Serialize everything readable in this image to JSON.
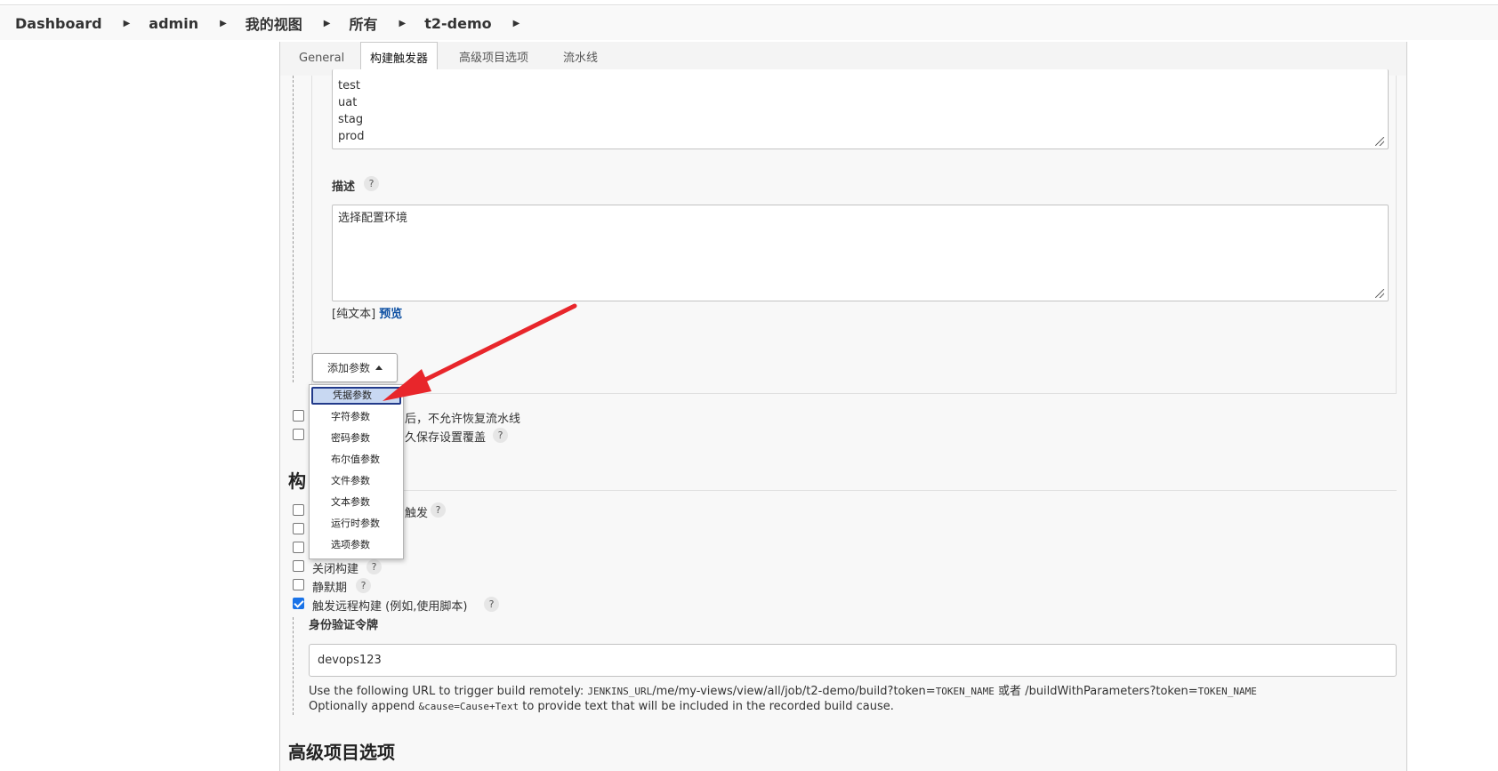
{
  "breadcrumb": [
    "Dashboard",
    "admin",
    "我的视图",
    "所有",
    "t2-demo"
  ],
  "tabs": [
    "General",
    "构建触发器",
    "高级项目选项",
    "流水线"
  ],
  "active_tab": "构建触发器",
  "choices_textarea": "test\nuat\nstag\nprod",
  "description": {
    "label": "描述",
    "value": "选择配置环境",
    "format_label": "[纯文本]",
    "preview_link": "预览"
  },
  "add_param_button": "添加参数",
  "dropdown_items": [
    "凭据参数",
    "字符参数",
    "密码参数",
    "布尔值参数",
    "文件参数",
    "文本参数",
    "运行时参数",
    "选项参数"
  ],
  "dropdown_selected": "凭据参数",
  "general_options": [
    {
      "label_visible": "后，不允许恢复流水线",
      "checked": false
    },
    {
      "label_visible": "久保存设置覆盖",
      "checked": false
    }
  ],
  "build_triggers": {
    "title_visible": "构",
    "items": [
      {
        "label_visible": "触发",
        "checked": false
      },
      {
        "label_visible": "",
        "checked": false
      },
      {
        "label_visible": "",
        "checked": false
      },
      {
        "label_visible": "关闭构建",
        "checked": false
      },
      {
        "label_visible": "静默期",
        "checked": false
      },
      {
        "label_visible": "触发远程构建 (例如,使用脚本)",
        "checked": true
      }
    ],
    "token_label": "身份验证令牌",
    "token_value": "devops123",
    "url_help_prefix": "Use the following URL to trigger build remotely: ",
    "url_env": "JENKINS_URL",
    "url_path": "/me/my-views/view/all/job/t2-demo/build?token=",
    "url_token": "TOKEN_NAME",
    "url_or": " 或者 ",
    "url_alt": "/buildWithParameters?token=",
    "cause_prefix": "Optionally append ",
    "cause_code": "&cause=Cause+Text",
    "cause_suffix": " to provide text that will be included in the recorded build cause."
  },
  "next_section_title": "高级项目选项",
  "help_icon": "?",
  "colors": {
    "link": "#0b4ea2",
    "arrow": "#e8262b",
    "selected_bg": "#c8d8f2",
    "checkbox_checked": "#1a73e8"
  }
}
